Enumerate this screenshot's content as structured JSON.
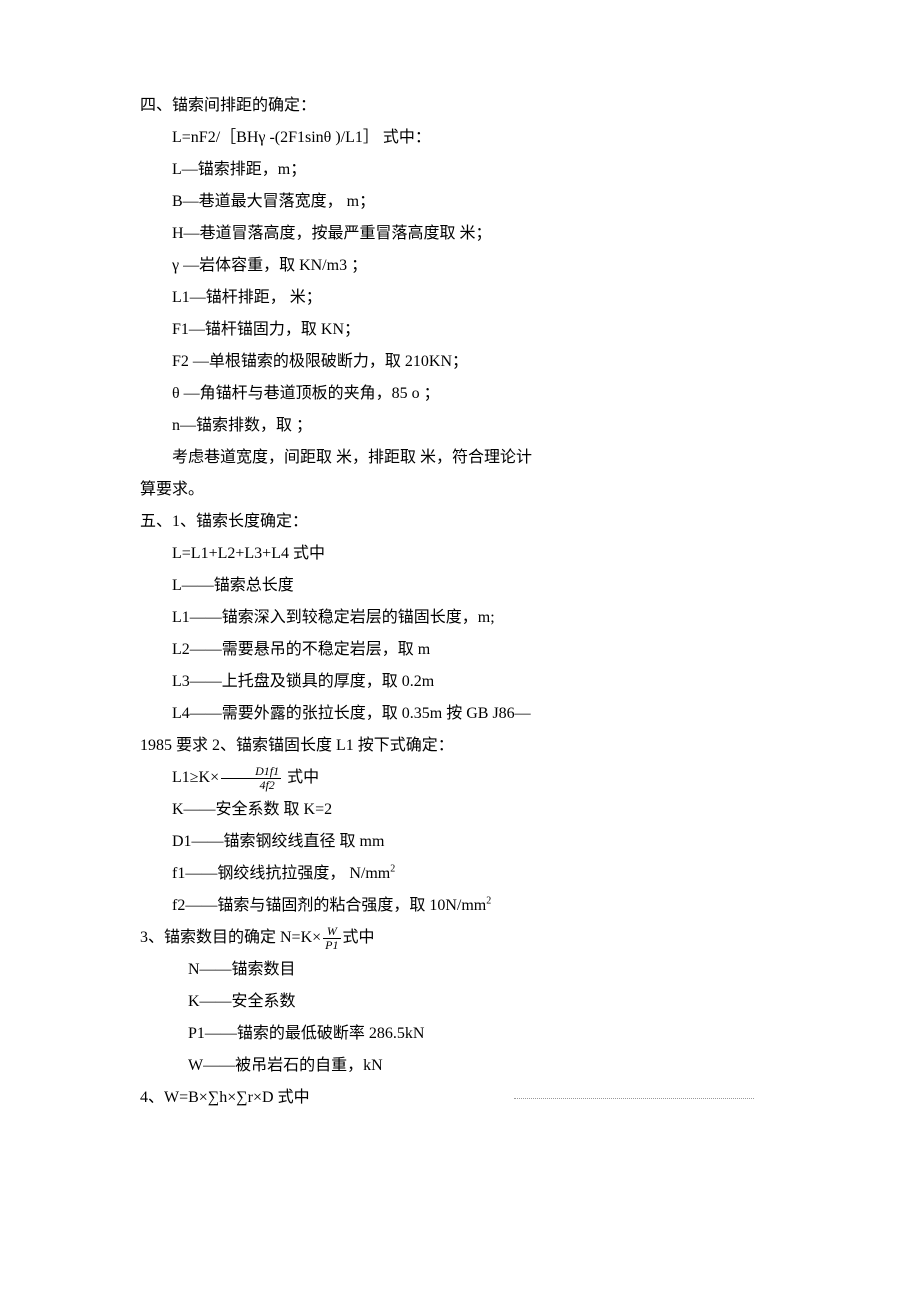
{
  "section4_title": "四、锚索间排距的确定：",
  "s4_formula": "L=nF2/［BHγ -(2F1sinθ )/L1］ 式中：",
  "s4_L": "L—锚索排距，m；",
  "s4_B": "B—巷道最大冒落宽度，  m；",
  "s4_H": "H—巷道冒落高度，按最严重冒落高度取    米；",
  "s4_g": "γ —岩体容重，取    KN/m3 ；",
  "s4_L1": "L1—锚杆排距，  米；",
  "s4_F1": "F1—锚杆锚固力，取    KN；",
  "s4_F2": "F2 —单根锚索的极限破断力，取 210KN；",
  "s4_theta": "θ —角锚杆与巷道顶板的夹角，85 o ；",
  "s4_n": "n—锚索排数，取    ；",
  "s4_conclusion1": "考虑巷道宽度，间距取    米，排距取    米，符合理论计",
  "s4_conclusion2": "算要求。",
  "section5_title": "五、1、锚索长度确定：",
  "s5_formula": "L=L1+L2+L3+L4  式中",
  "s5_L": "L——锚索总长度",
  "s5_L1": "L1——锚索深入到较稳定岩层的锚固长度，m;",
  "s5_L2": "L2——需要悬吊的不稳定岩层，取    m",
  "s5_L3": "L3——上托盘及锁具的厚度，取 0.2m",
  "s5_L4": "L4——需要外露的张拉长度，取 0.35m 按 GB J86—",
  "s5_last": "1985 要求 2、锚索锚固长度 L1 按下式确定：",
  "s5_2_prefix": "L1≥K×",
  "s5_2_num": "D1f1",
  "s5_2_den": "4f2",
  "s5_2_suffix": "  式中",
  "s5_K": "K——安全系数  取 K=2",
  "s5_D1": "D1——锚索钢绞线直径  取      mm",
  "s5_f1": "f1——钢绞线抗拉强度，  N/mm",
  "s5_f2": "f2——锚索与锚固剂的粘合强度，取 10N/mm",
  "s5_3_prefix": "3、锚索数目的确定  N=K×",
  "s5_3_num": "W",
  "s5_3_den": "P1",
  "s5_3_suffix": "式中",
  "s5_3_N": "N——锚索数目",
  "s5_3_K": "K——安全系数",
  "s5_3_P1": "P1——锚索的最低破断率 286.5kN",
  "s5_3_W": "W——被吊岩石的自重，kN",
  "s5_4": "4、W=B×∑h×∑r×D  式中",
  "sup2": "2"
}
